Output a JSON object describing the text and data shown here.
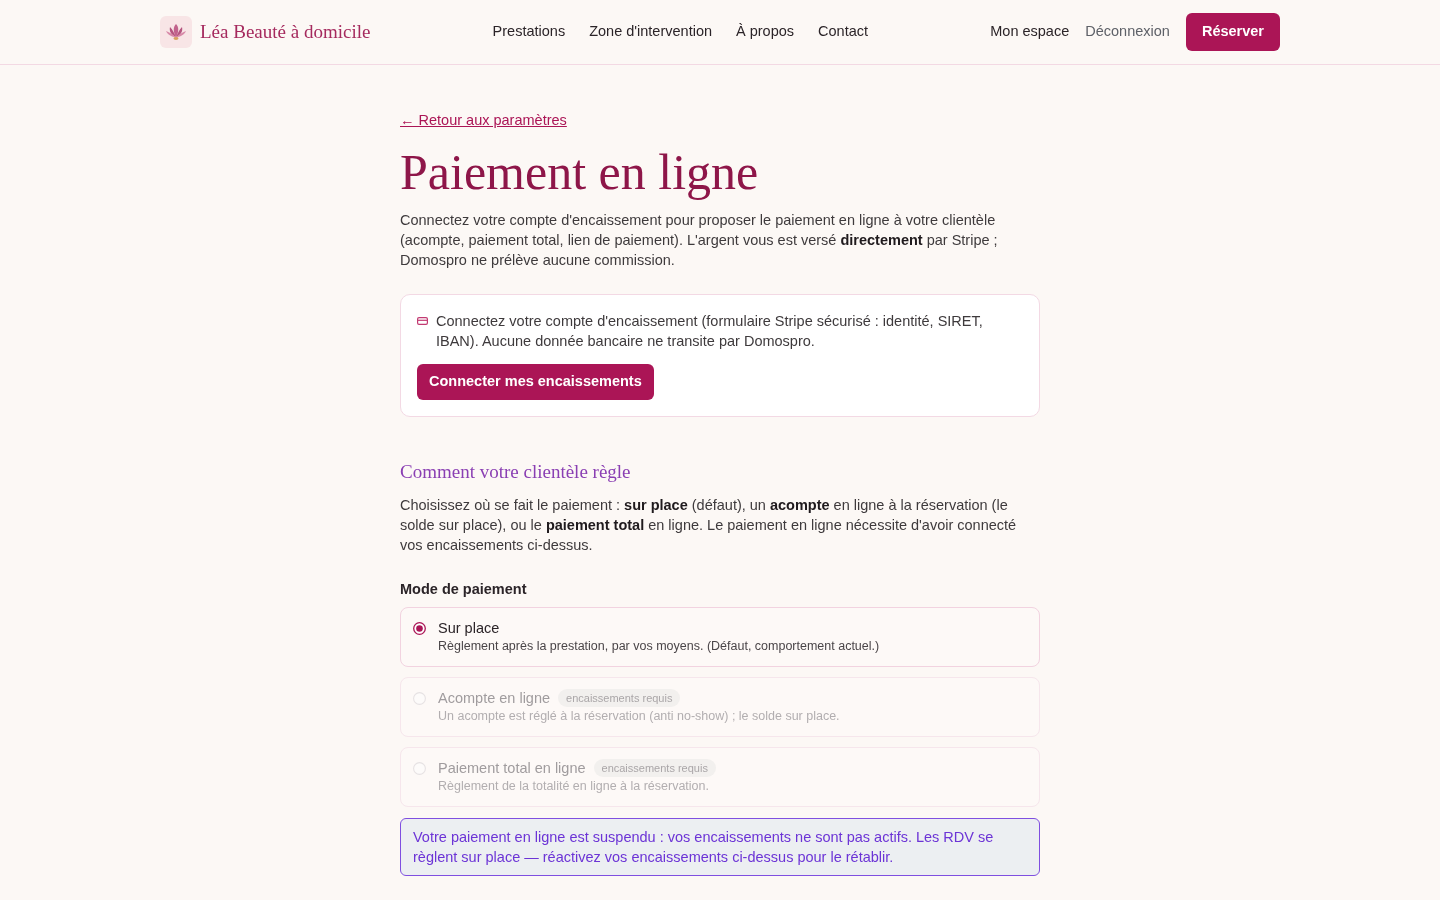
{
  "header": {
    "brand": "Léa Beauté à domicile",
    "nav": [
      "Prestations",
      "Zone d'intervention",
      "À propos",
      "Contact"
    ],
    "account_link": "Mon espace",
    "logout_link": "Déconnexion",
    "book_button": "Réserver"
  },
  "back_link": "← Retour aux paramètres",
  "title": "Paiement en ligne",
  "intro": "Connectez votre compte d'encaissement pour proposer le paiement en ligne à votre clientèle (acompte, paiement total, lien de paiement). L'argent vous est versé **directement** par Stripe ; Domospro ne prélève aucune commission.",
  "connect_card": {
    "text": "Connectez votre compte d'encaissement (formulaire Stripe sécurisé : identité, SIRET, IBAN). Aucune donnée bancaire ne transite par Domospro.",
    "button": "Connecter mes encaissements"
  },
  "section": {
    "title": "Comment votre clientèle règle",
    "description": "Choisissez où se fait le paiement : **sur place** (défaut), un **acompte** en ligne à la réservation (le solde sur place), ou le **paiement total** en ligne. Le paiement en ligne nécessite d'avoir connecté vos encaissements ci-dessus.",
    "field_label": "Mode de paiement",
    "options": [
      {
        "label": "Sur place",
        "description": "Règlement après la prestation, par vos moyens. (Défaut, comportement actuel.)",
        "selected": true,
        "disabled": false
      },
      {
        "label": "Acompte en ligne",
        "badge": "encaissements requis",
        "description": "Un acompte est réglé à la réservation (anti no-show) ; le solde sur place.",
        "selected": false,
        "disabled": true
      },
      {
        "label": "Paiement total en ligne",
        "badge": "encaissements requis",
        "description": "Règlement de la totalité en ligne à la réservation.",
        "selected": false,
        "disabled": true
      }
    ]
  },
  "alert": "Votre paiement en ligne est suspendu : vos encaissements ne sont pas actifs. Les RDV se règlent sur place — réactivez vos encaissements ci-dessus pour le rétablir."
}
